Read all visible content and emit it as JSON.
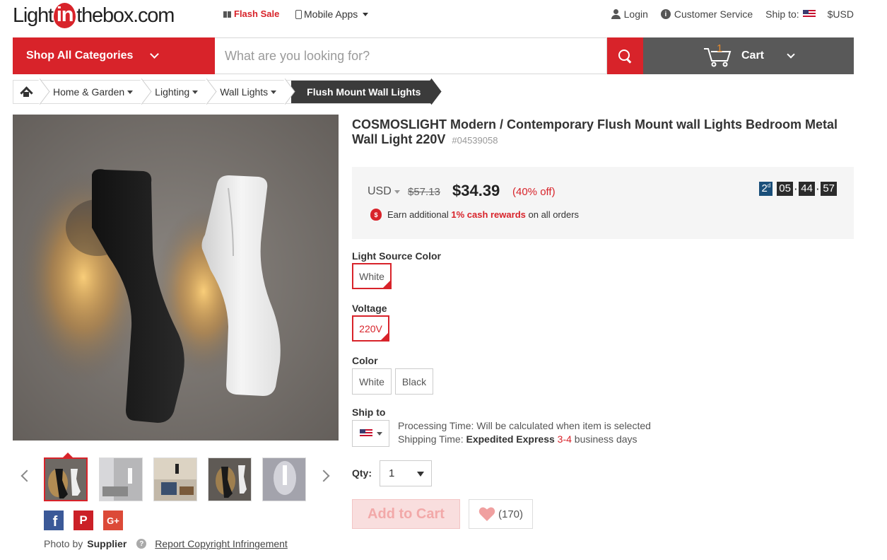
{
  "header": {
    "logo": {
      "pre": "Light",
      "mid": "in",
      "post": "thebox.com"
    },
    "flash_sale": "Flash Sale",
    "mobile_apps": "Mobile Apps",
    "login": "Login",
    "customer_service": "Customer Service",
    "ship_to_label": "Ship to:",
    "currency": "$USD"
  },
  "nav": {
    "shop_all": "Shop All Categories",
    "search_placeholder": "What are you looking for?",
    "cart_label": "Cart",
    "cart_count": "1"
  },
  "breadcrumb": {
    "items": [
      "Home & Garden",
      "Lighting",
      "Wall Lights"
    ],
    "current": "Flush Mount Wall Lights"
  },
  "product": {
    "title": "COSMOSLIGHT Modern / Contemporary Flush Mount wall Lights Bedroom Metal Wall Light 220V",
    "sku": "#04539058",
    "currency": "USD",
    "old_price": "$57.13",
    "price": "$34.39",
    "discount_open": "(",
    "discount_pct": "40% off",
    "discount_close": ")",
    "reward_pre": "Earn additional",
    "reward_highlight": "1% cash rewards",
    "reward_post": "on all orders",
    "timer": {
      "days": "2",
      "day_unit": "d",
      "hours": "05",
      "minutes": "44",
      "seconds": "57"
    }
  },
  "options": {
    "light_source_color_label": "Light Source Color",
    "light_source_color_value": "White",
    "voltage_label": "Voltage",
    "voltage_value": "220V",
    "color_label": "Color",
    "color_values": [
      "White",
      "Black"
    ],
    "ship_to_label": "Ship to",
    "processing_time": "Processing Time: Will be calculated when item is selected",
    "shipping_time_pre": "Shipping Time:",
    "shipping_method": "Expedited Express",
    "shipping_days": "3-4",
    "shipping_time_post": "business days",
    "qty_label": "Qty:",
    "qty_value": "1",
    "add_to_cart": "Add to Cart",
    "wishlist_count": "(170)"
  },
  "gallery": {
    "photo_by": "Photo by",
    "supplier": "Supplier",
    "report": "Report Copyright Infringement"
  },
  "colors": {
    "brand_red": "#d8232a",
    "dark_bar": "#595959",
    "timer_day": "#1a4f7a"
  }
}
